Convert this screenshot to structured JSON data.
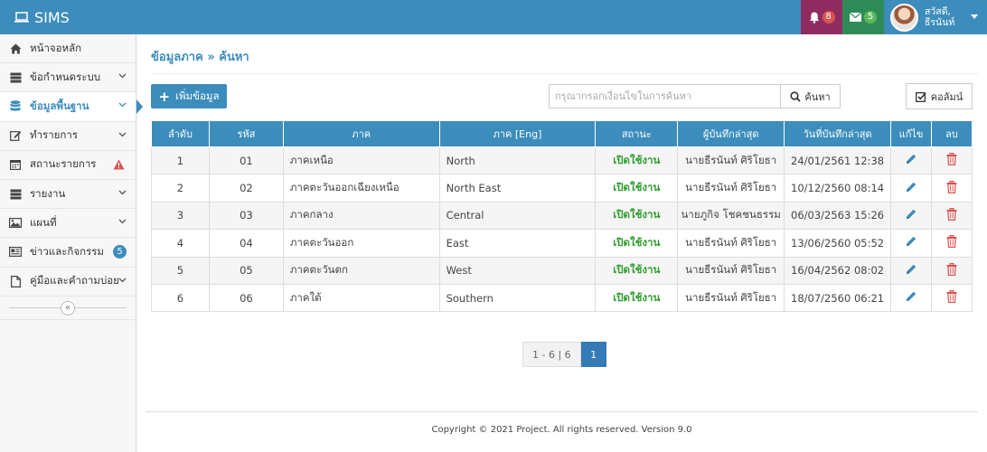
{
  "app": {
    "title": "SIMS"
  },
  "header": {
    "notifications_count": "8",
    "messages_count": "5",
    "user_line1": "สวัสดี,",
    "user_line2": "ธีรนันท์",
    "notif_color": "#d9534f",
    "msg_color": "#5cb85c"
  },
  "sidebar": {
    "items": [
      {
        "label": "หน้าจอหลัก",
        "icon": "home-icon"
      },
      {
        "label": "ข้อกำหนดระบบ",
        "icon": "server-icon"
      },
      {
        "label": "ข้อมูลพื้นฐาน",
        "icon": "database-icon"
      },
      {
        "label": "ทำรายการ",
        "icon": "edit-icon"
      },
      {
        "label": "สถานะรายการ",
        "icon": "calendar-icon"
      },
      {
        "label": "รายงาน",
        "icon": "server-icon"
      },
      {
        "label": "แผนที่",
        "icon": "image-icon"
      },
      {
        "label": "ข่าวและกิจกรรม",
        "icon": "newspaper-icon",
        "badge": "5"
      },
      {
        "label": "คู่มือและคำถามบ่อย",
        "icon": "file-icon"
      }
    ],
    "collapse_glyph": "«"
  },
  "main": {
    "breadcrumb": "ข้อมูลภาค » ค้นหา",
    "add_label": "เพิ่มข้อมูล",
    "search_placeholder": "กรุณากรอกเงื่อนไขในการค้นหา",
    "search_label": "ค้นหา",
    "columns_label": "คอลัมน์"
  },
  "table": {
    "headers": [
      "ลำดับ",
      "รหัส",
      "ภาค",
      "ภาค [Eng]",
      "สถานะ",
      "ผู้บันทึกล่าสุด",
      "วันที่บันทึกล่าสุด",
      "แก้ไข",
      "ลบ"
    ],
    "rows": [
      {
        "no": "1",
        "code": "01",
        "name": "ภาคเหนือ",
        "name_en": "North",
        "status": "เปิดใช้งาน",
        "user": "นายธีรนันท์ ศิริโยธา",
        "date": "24/01/2561 12:38"
      },
      {
        "no": "2",
        "code": "02",
        "name": "ภาคตะวันออกเฉียงเหนือ",
        "name_en": "North East",
        "status": "เปิดใช้งาน",
        "user": "นายธีรนันท์ ศิริโยธา",
        "date": "10/12/2560 08:14"
      },
      {
        "no": "3",
        "code": "03",
        "name": "ภาคกลาง",
        "name_en": "Central",
        "status": "เปิดใช้งาน",
        "user": "นายภูกิจ โชคชนธรรม",
        "date": "06/03/2563 15:26"
      },
      {
        "no": "4",
        "code": "04",
        "name": "ภาคตะวันออก",
        "name_en": "East",
        "status": "เปิดใช้งาน",
        "user": "นายธีรนันท์ ศิริโยธา",
        "date": "13/06/2560 05:52"
      },
      {
        "no": "5",
        "code": "05",
        "name": "ภาคตะวันตก",
        "name_en": "West",
        "status": "เปิดใช้งาน",
        "user": "นายธีรนันท์ ศิริโยธา",
        "date": "16/04/2562 08:02"
      },
      {
        "no": "6",
        "code": "06",
        "name": "ภาคใต้",
        "name_en": "Southern",
        "status": "เปิดใช้งาน",
        "user": "นายธีรนันท์ ศิริโยธา",
        "date": "18/07/2560 06:21"
      }
    ]
  },
  "pagination": {
    "info": "1 - 6 | 6",
    "current": "1"
  },
  "footer": {
    "text": "Copyright © 2021 Project. All rights reserved. Version 9.0"
  },
  "colors": {
    "primary": "#3c8dbc",
    "status_active": "#2e9e2e",
    "delete": "#d9534f",
    "edit": "#3c8dbc"
  }
}
